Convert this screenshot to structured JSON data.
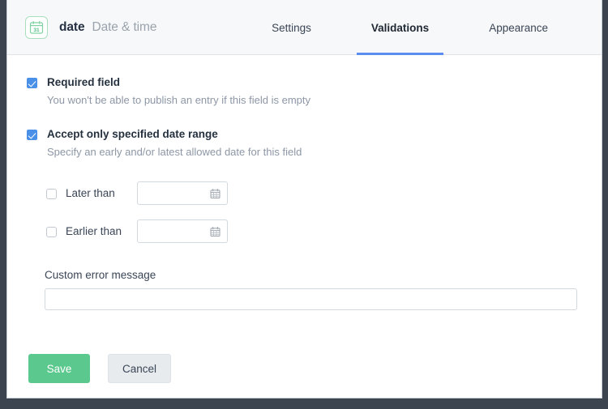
{
  "header": {
    "icon_name": "calendar-31-icon",
    "icon_day": "31",
    "field_name": "date",
    "field_type": "Date & time",
    "tabs": [
      {
        "label": "Settings",
        "active": false
      },
      {
        "label": "Validations",
        "active": true
      },
      {
        "label": "Appearance",
        "active": false
      }
    ]
  },
  "validations": {
    "required": {
      "label": "Required field",
      "description": "You won't be able to publish an entry if this field is empty",
      "checked": true
    },
    "date_range": {
      "label": "Accept only specified date range",
      "description": "Specify an early and/or latest allowed date for this field",
      "checked": true,
      "later_than": {
        "label": "Later than",
        "checked": false,
        "value": "",
        "icon_name": "calendar-icon"
      },
      "earlier_than": {
        "label": "Earlier than",
        "checked": false,
        "value": "",
        "icon_name": "calendar-icon"
      }
    },
    "custom_error": {
      "label": "Custom error message",
      "value": "",
      "placeholder": ""
    }
  },
  "footer": {
    "save_label": "Save",
    "cancel_label": "Cancel"
  },
  "colors": {
    "accent_blue": "#5b8def",
    "checkbox_blue": "#4a90e8",
    "save_green": "#5bc98d",
    "icon_green": "#6ecb96",
    "header_bg": "#f7f8f9",
    "window_chrome": "#3c444f"
  }
}
